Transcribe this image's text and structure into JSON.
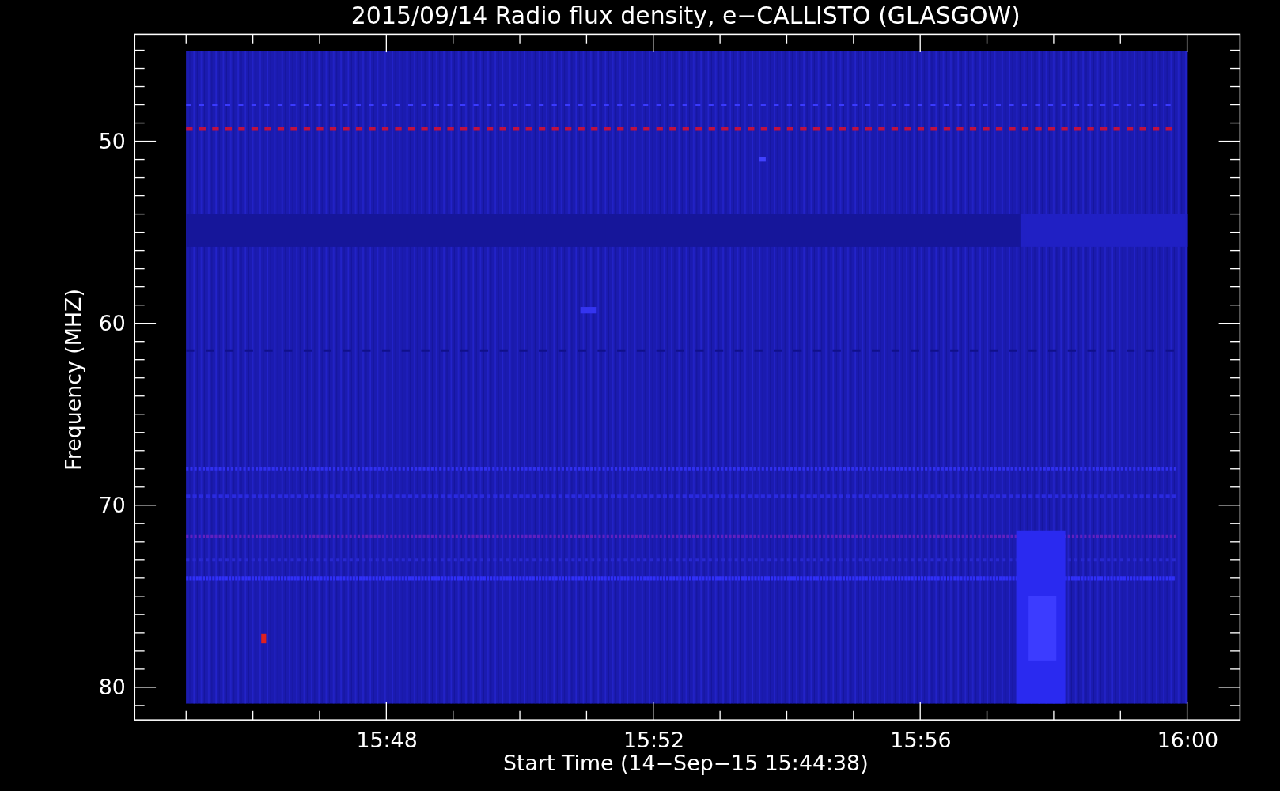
{
  "plot": {
    "title": "2015/09/14  Radio flux density, e−CALLISTO (GLASGOW)",
    "ylabel": "Frequency (MHZ)",
    "xlabel": "Start Time (14−Sep−15 15:44:38)",
    "yticks": [
      "50",
      "60",
      "70",
      "80"
    ],
    "xticks": [
      "15:48",
      "15:52",
      "15:56",
      "16:00"
    ]
  }
}
